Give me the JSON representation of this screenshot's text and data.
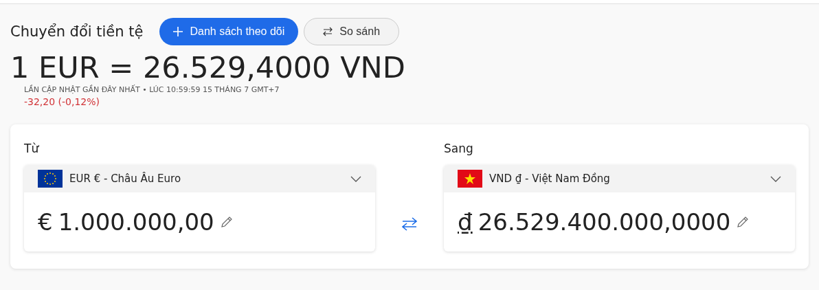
{
  "title": "Chuyển đổi tiền tệ",
  "buttons": [
    {
      "label": "Danh sách theo dõi",
      "kind": "primary"
    },
    {
      "label": "So sánh",
      "kind": "secondary"
    }
  ],
  "rate": "1 EUR = 26.529,4000 VND",
  "updated": "LẦN CẬP NHẬT GẦN ĐÂY NHẤT • LÚC 10:59:59 15 THÁNG 7 GMT+7",
  "change": "-32,20 (-0,12%)",
  "converter": {
    "panels": [
      {
        "label": "Từ",
        "currency": "EUR € - Châu Âu Euro",
        "symbol": "€",
        "amount": "1.000.000,00"
      },
      {
        "label": "Sang",
        "currency": "VND ₫ - Việt Nam Đồng",
        "symbol": "₫",
        "amount": "26.529.400.000,0000"
      }
    ]
  }
}
